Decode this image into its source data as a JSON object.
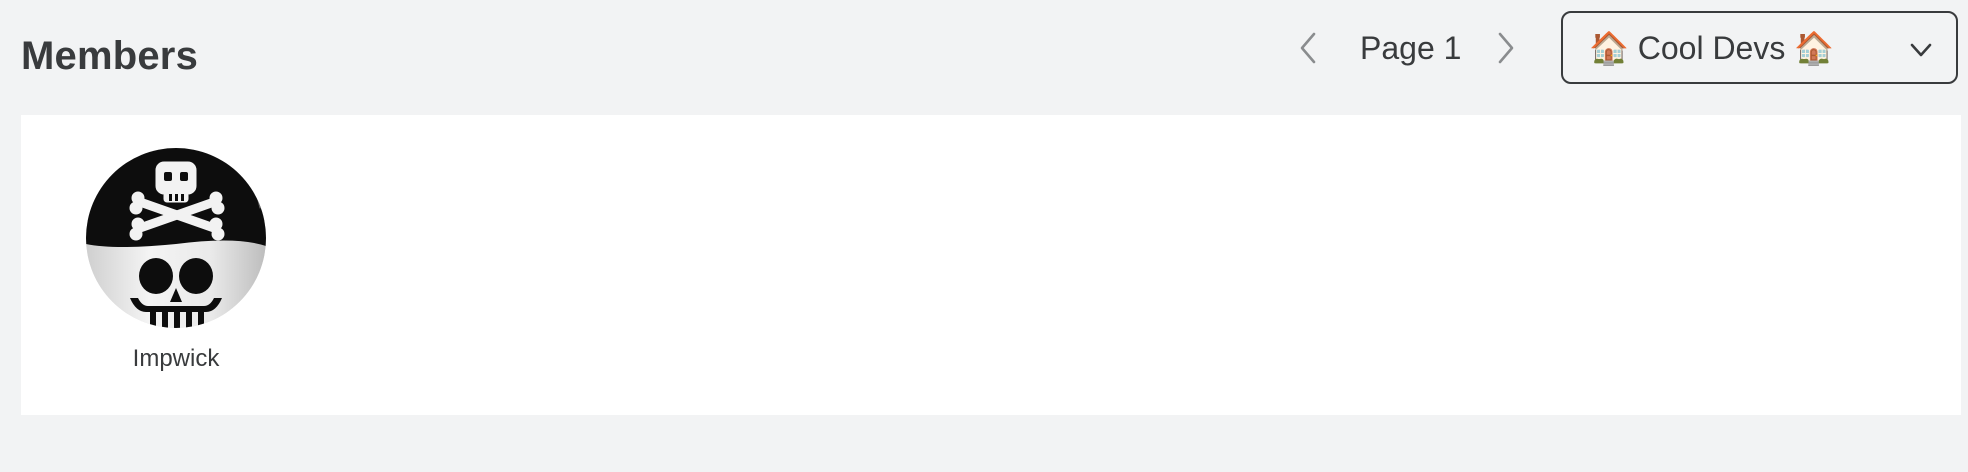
{
  "header": {
    "title": "Members"
  },
  "pager": {
    "label": "Page 1",
    "prev_icon": "chevron-left-icon",
    "next_icon": "chevron-right-icon"
  },
  "group_select": {
    "selected": "🏠 Cool Devs 🏠",
    "icon": "chevron-down-icon"
  },
  "members": [
    {
      "name": "Impwick",
      "avatar": "pirate-skeleton-avatar"
    }
  ],
  "colors": {
    "background": "#f2f3f4",
    "panel": "#ffffff",
    "text": "#393b3d",
    "pager_arrow": "#8a8c8e"
  }
}
